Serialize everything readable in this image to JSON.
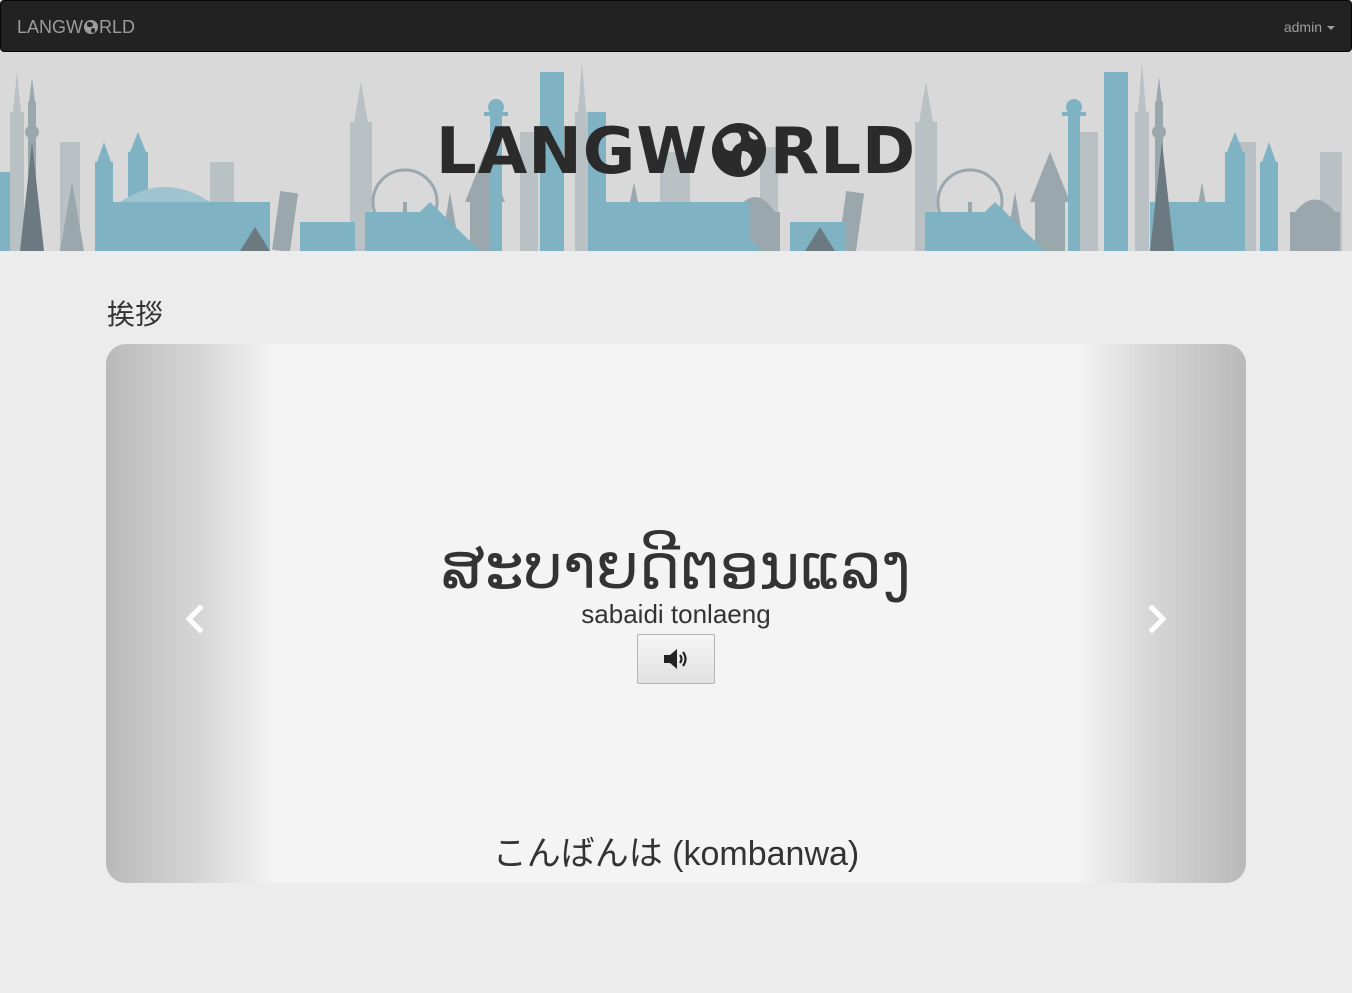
{
  "navbar": {
    "brand_prefix": "LANGW",
    "brand_suffix": "RLD",
    "user_label": "admin"
  },
  "banner": {
    "logo_prefix": "LANGW",
    "logo_suffix": "RLD"
  },
  "section": {
    "title": "挨拶"
  },
  "carousel": {
    "phrase": "ສະບາຍດີຕອນແລງ",
    "romanized": "sabaidi tonlaeng",
    "caption": "こんばんは (kombanwa)"
  },
  "icons": {
    "prev": "chevron-left-icon",
    "next": "chevron-right-icon",
    "audio": "volume-up-icon",
    "user_menu": "caret-down-icon"
  },
  "colors": {
    "navbar_bg": "#222222",
    "navbar_text": "#9d9d9d",
    "banner_bg": "#d9d9d9",
    "skyline_teal": "#7fb2c2",
    "skyline_grey": "#9aa7ad",
    "page_bg": "#ececec",
    "logo_text": "#2b2b2b"
  }
}
